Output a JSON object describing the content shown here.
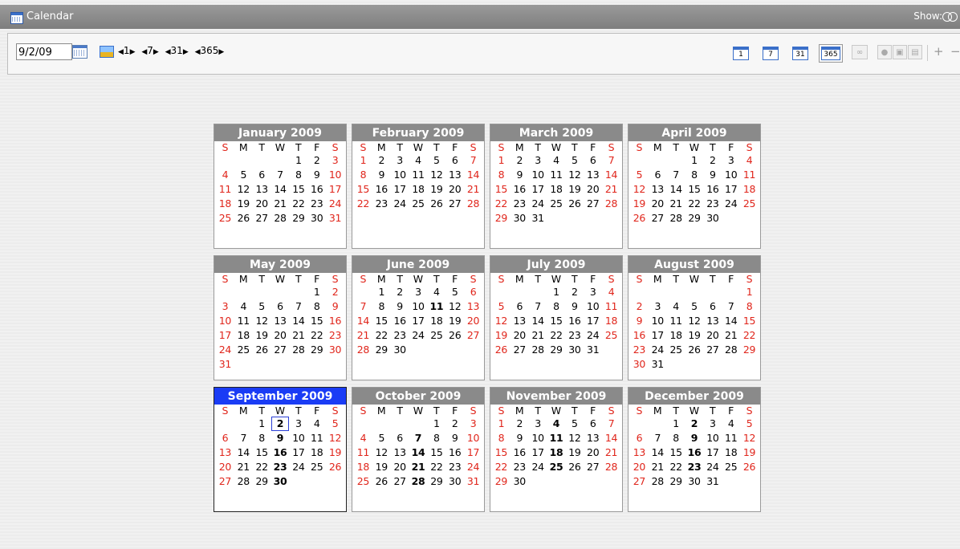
{
  "window": {
    "title": "Calendar",
    "show_label": "Show:"
  },
  "toolbar": {
    "date_value": "9/2/09",
    "steppers": [
      "1",
      "7",
      "31",
      "365"
    ],
    "view_buttons": [
      "1",
      "7",
      "31",
      "365"
    ],
    "selected_view": "365",
    "plus": "+",
    "minus": "−"
  },
  "day_headers": [
    "S",
    "M",
    "T",
    "W",
    "T",
    "F",
    "S"
  ],
  "today": {
    "month": "September 2009",
    "day": 2
  },
  "months": [
    {
      "name": "January 2009",
      "first_dow": 4,
      "days": 31,
      "bold": []
    },
    {
      "name": "February 2009",
      "first_dow": 0,
      "days": 28,
      "bold": []
    },
    {
      "name": "March 2009",
      "first_dow": 0,
      "days": 31,
      "bold": []
    },
    {
      "name": "April 2009",
      "first_dow": 3,
      "days": 30,
      "bold": []
    },
    {
      "name": "May 2009",
      "first_dow": 5,
      "days": 31,
      "bold": []
    },
    {
      "name": "June 2009",
      "first_dow": 1,
      "days": 30,
      "bold": [
        11
      ]
    },
    {
      "name": "July 2009",
      "first_dow": 3,
      "days": 31,
      "bold": []
    },
    {
      "name": "August 2009",
      "first_dow": 6,
      "days": 31,
      "bold": []
    },
    {
      "name": "September 2009",
      "first_dow": 2,
      "days": 30,
      "bold": [
        2,
        9,
        16,
        23,
        30
      ]
    },
    {
      "name": "October 2009",
      "first_dow": 4,
      "days": 31,
      "bold": [
        7,
        14,
        21,
        28
      ]
    },
    {
      "name": "November 2009",
      "first_dow": 0,
      "days": 30,
      "bold": [
        4,
        11,
        18,
        25
      ]
    },
    {
      "name": "December 2009",
      "first_dow": 2,
      "days": 31,
      "bold": [
        2,
        9,
        16,
        23
      ]
    }
  ],
  "colors": {
    "weekend": "#e0251b",
    "header": "#8a8a8a",
    "current_header": "#1a3cf5"
  }
}
